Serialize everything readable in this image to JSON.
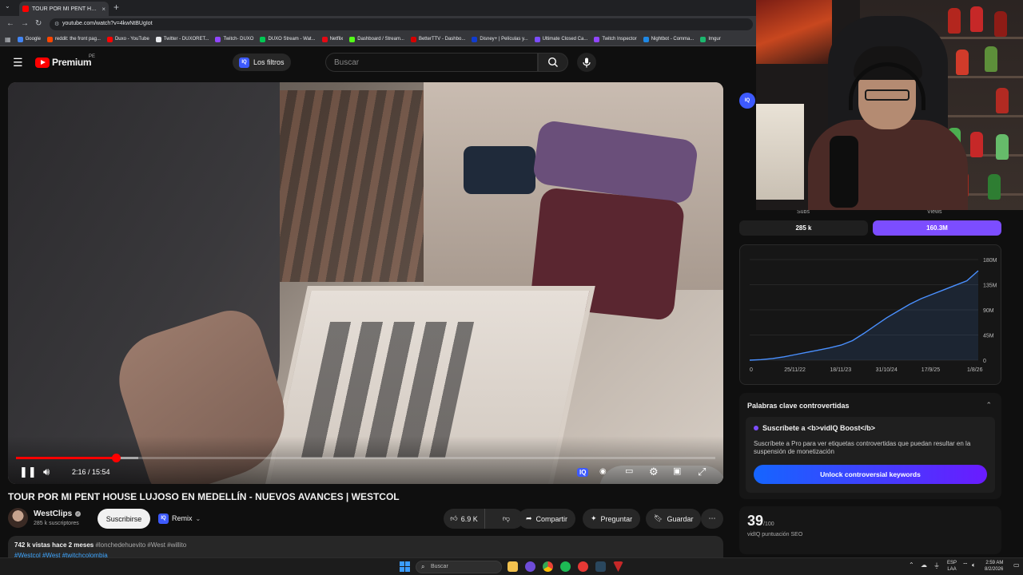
{
  "browser": {
    "tab_title": "TOUR POR MI PENT HOUSE",
    "tab_close": "×",
    "new_tab": "+",
    "url": "youtube.com/watch?v=4kwNtBUgIot",
    "bookmarks": [
      {
        "label": "Google",
        "color": "#4285f4"
      },
      {
        "label": "reddit: the front pag...",
        "color": "#ff4500"
      },
      {
        "label": "Duxo - YouTube",
        "color": "#ff0000"
      },
      {
        "label": "Twitter - DUXORET...",
        "color": "#e8eaed"
      },
      {
        "label": "Twitch- DUXO",
        "color": "#9146ff"
      },
      {
        "label": "DUXO Stream - Wat...",
        "color": "#00c853"
      },
      {
        "label": "Netflix",
        "color": "#e50914"
      },
      {
        "label": "Dashboard / Stream...",
        "color": "#53fc18"
      },
      {
        "label": "BetterTTV - Dashbo...",
        "color": "#d50000"
      },
      {
        "label": "Disney+ | Películas y...",
        "color": "#113ccf"
      },
      {
        "label": "Ultimate Closed Ca...",
        "color": "#7c4dff"
      },
      {
        "label": "Twitch Inspector",
        "color": "#9146ff"
      },
      {
        "label": "Nightbot - Comma...",
        "color": "#1e88e5"
      },
      {
        "label": "Imgur",
        "color": "#1bb76e"
      }
    ]
  },
  "header": {
    "logo_text": "Premium",
    "region": "PE",
    "filters_label": "Los filtros",
    "search_placeholder": "Buscar"
  },
  "player": {
    "current_time": "2:16",
    "duration": "15:54",
    "time_display": "2:16 / 15:54",
    "progress_played": 0.143,
    "progress_buffered": 0.175
  },
  "video": {
    "title": "TOUR POR MI PENT HOUSE LUJOSO EN MEDELLÍN - NUEVOS AVANCES | WESTCOL",
    "channel": "WestClips",
    "subscribers": "285 k suscriptores",
    "subscribe_label": "Suscribirse",
    "remix_label": "Remix",
    "likes": "6.9 K",
    "share_label": "Compartir",
    "ask_label": "Preguntar",
    "save_label": "Guardar",
    "description": {
      "views": "742 k vistas",
      "age": "hace 2 meses",
      "tags": "#lonchedehuevito #West #willito",
      "links": "#Westcol #West #twitchcolombia"
    }
  },
  "vidiq": {
    "badge": "IQ",
    "subs_label": "Subs",
    "views_label": "Views",
    "subs_value": "285 k",
    "views_value": "160.3M",
    "keywords_title": "Palabras clave controvertidas",
    "keywords_heading": "Suscríbete a <b>vidIQ Boost</b>",
    "keywords_text": "Suscríbete a Pro para ver etiquetas controvertidas que puedan resultar en la suspensión de monetización",
    "unlock_label": "Unlock controversial keywords",
    "seo_score": "39",
    "seo_max": "/100",
    "seo_label": "vidIQ puntuación SEO",
    "accent": "#7c4dff"
  },
  "chart_data": {
    "type": "line",
    "title": "",
    "xlabel": "",
    "ylabel": "",
    "x_ticks": [
      "0",
      "25/11/22",
      "18/11/23",
      "31/10/24",
      "17/9/25",
      "1/8/26"
    ],
    "y_ticks": [
      "0",
      "45M",
      "90M",
      "135M",
      "180M"
    ],
    "ylim": [
      0,
      180
    ],
    "x": [
      0,
      0.05,
      0.1,
      0.15,
      0.2,
      0.25,
      0.3,
      0.35,
      0.4,
      0.45,
      0.5,
      0.55,
      0.6,
      0.65,
      0.7,
      0.75,
      0.8,
      0.85,
      0.9,
      0.95,
      1.0
    ],
    "values": [
      0,
      1,
      3,
      6,
      10,
      14,
      18,
      22,
      27,
      35,
      48,
      62,
      76,
      88,
      100,
      110,
      118,
      126,
      134,
      142,
      160
    ],
    "color": "#4a90ff"
  },
  "taskbar": {
    "search_placeholder": "Buscar",
    "lang_line1": "ESP",
    "lang_line2": "LAA",
    "time": "2:59 AM",
    "date": "8/2/2026"
  }
}
